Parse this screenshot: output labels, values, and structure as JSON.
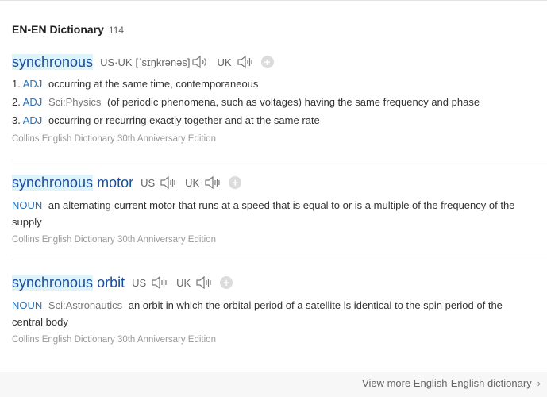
{
  "header": {
    "title": "EN-EN Dictionary",
    "count": "114"
  },
  "entries": [
    {
      "word_main": "synchronous",
      "word_rest": "",
      "us_label": "US·UK",
      "ipa": "[ˈsɪŋkrənəs]",
      "uk_label": "UK",
      "add_label": "+",
      "defs": [
        {
          "num": "1.",
          "pos": "ADJ",
          "domain": "",
          "text": "occurring at the same time, contemporaneous"
        },
        {
          "num": "2.",
          "pos": "ADJ",
          "domain": "Sci:Physics",
          "text": "(of periodic phenomena, such as voltages) having the same frequency and phase"
        },
        {
          "num": "3.",
          "pos": "ADJ",
          "domain": "",
          "text": "occurring or recurring exactly together and at the same rate"
        }
      ],
      "source": "Collins English Dictionary 30th Anniversary Edition"
    },
    {
      "word_main": "synchronous",
      "word_rest": "motor",
      "us_label": "US",
      "uk_label": "UK",
      "add_label": "+",
      "pos": "NOUN",
      "domain": "",
      "text": "an alternating-current motor that runs at a speed that is equal to or is a multiple of the frequency of the supply",
      "source": "Collins English Dictionary 30th Anniversary Edition"
    },
    {
      "word_main": "synchronous",
      "word_rest": "orbit",
      "us_label": "US",
      "uk_label": "UK",
      "add_label": "+",
      "pos": "NOUN",
      "domain": "Sci:Astronautics",
      "text": "an orbit in which the orbital period of a satellite is identical to the spin period of the central body",
      "source": "Collins English Dictionary 30th Anniversary Edition"
    }
  ],
  "footer": {
    "more_label": "View more English-English dictionary",
    "chevron": "›"
  },
  "colors": {
    "headword": "#1a4c9c",
    "highlight": "#dff3fb",
    "pos": "#2b6fb5",
    "muted": "#999999"
  },
  "icons": {
    "speaker": "speaker-icon",
    "add": "plus-circle-icon",
    "chevron": "chevron-right-icon"
  }
}
